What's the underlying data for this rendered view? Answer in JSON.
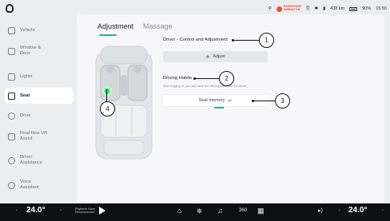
{
  "status": {
    "airbag_line1": "PASSENGER",
    "airbag_line2": "AIRBAG ON",
    "range": "438 km",
    "battery": "90%",
    "time": "15:55"
  },
  "sidebar": {
    "items": [
      {
        "label": "Vehicle",
        "icon": "car-icon"
      },
      {
        "label": "Window & Door",
        "icon": "window-icon"
      },
      {
        "label": "Lights",
        "icon": "lights-icon"
      },
      {
        "label": "Seat",
        "icon": "seat-icon"
      },
      {
        "label": "Drive",
        "icon": "steering-icon"
      },
      {
        "label": "Real-time VR Assist",
        "icon": "vr-icon"
      },
      {
        "label": "Driver Assistance",
        "icon": "assist-icon"
      },
      {
        "label": "Voice Assistant",
        "icon": "voice-icon"
      }
    ],
    "active": "Seat"
  },
  "tabs": [
    {
      "label": "Adjustment",
      "active": true
    },
    {
      "label": "Massage",
      "active": false
    }
  ],
  "main": {
    "driver_title": "Driver - Control and Adjustment",
    "adjust_label": "Adjust",
    "habits_title": "Driving Habits",
    "habits_desc": "After logging in, you can save the driving habits for the driver",
    "seat_memory_label": "Seat memory"
  },
  "callouts": [
    "1",
    "2",
    "3",
    "4"
  ],
  "bottom": {
    "temp_left": "24.0°",
    "temp_right": "24.0°",
    "music_line1": "Rhythmic Vibes",
    "music_line2": "Recommended",
    "dock_360": "360"
  },
  "colors": {
    "accent": "#2fae8f",
    "seat_highlight": "#3ddc7a",
    "airbag": "#e0513d"
  }
}
